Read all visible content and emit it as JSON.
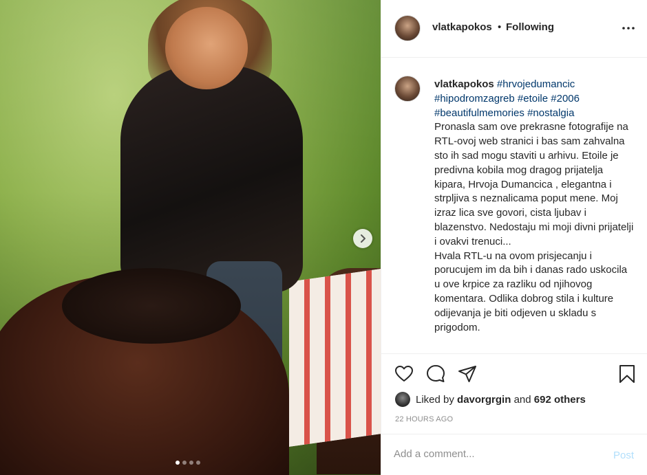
{
  "post": {
    "username": "vlatkapokos",
    "separator": "•",
    "follow_status": "Following",
    "more_icon": "more-horizontal-icon"
  },
  "caption": {
    "username": "vlatkapokos",
    "hashtags_line1": "#hrvojedumancic",
    "hashtags_line2": "#hipodromzagreb #etoile #2006",
    "hashtags_line3": "#beautifulmemories #nostalgia",
    "body": "Pronasla sam ove prekrasne fotografije na RTL-ovoj web stranici i bas sam zahvalna sto ih sad mogu staviti u arhivu. Etoile je predivna kobila mog dragog prijatelja kipara, Hrvoja Dumancica , elegantna i strpljiva s neznalicama poput mene. Moj izraz lica sve govori, cista ljubav i blazenstvo. Nedostaju mi moji divni prijatelji i ovakvi trenuci...",
    "body2": "Hvala RTL-u na ovom prisjecanju i porucujem im da bih i danas rado uskocila u ove krpice za razliku od njihovog komentara. Odlika dobrog stila i kulture odijevanja je biti odjeven u skladu s prigodom."
  },
  "likes": {
    "prefix": "Liked by",
    "user": "davorgrgin",
    "connector": "and",
    "others": "692 others"
  },
  "timestamp": "22 HOURS AGO",
  "comment": {
    "placeholder": "Add a comment...",
    "post_label": "Post"
  },
  "carousel": {
    "total": 4,
    "active_index": 0
  },
  "colors": {
    "hashtag": "#00376b",
    "post_disabled": "#b2dffc",
    "muted": "#8e8e8e"
  }
}
